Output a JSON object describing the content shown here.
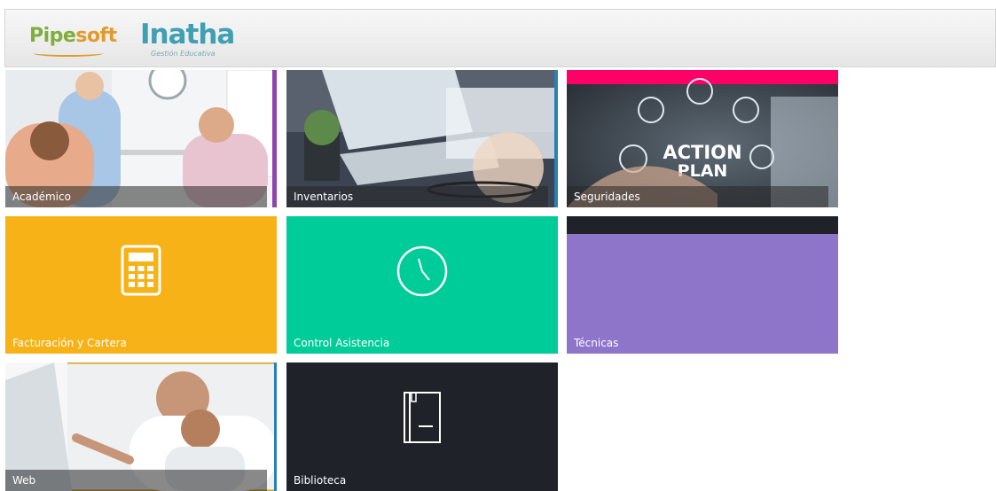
{
  "header": {
    "logo_pipesoft_pre": "Pipe",
    "logo_pipesoft_post": "soft",
    "logo_inatha": "Inatha",
    "logo_inatha_sub": "Gestión Educativa"
  },
  "tiles": [
    {
      "label": "Académico",
      "kind": "photo",
      "accent": "#8e44ad"
    },
    {
      "label": "Inventarios",
      "kind": "photo",
      "accent": "#2980b9"
    },
    {
      "label": "Seguridades",
      "kind": "photo",
      "accent": "#ff0066"
    },
    {
      "label": "Facturación y Cartera",
      "kind": "icon",
      "icon": "calculator-icon",
      "color": "#f7b217"
    },
    {
      "label": "Control Asistencia",
      "kind": "icon",
      "icon": "clock-icon",
      "color": "#00cc99"
    },
    {
      "label": "Técnicas",
      "kind": "plain",
      "color": "#8e75c9",
      "top_band": "#1f2329"
    },
    {
      "label": "Web",
      "kind": "photo",
      "accent": "#d4a017"
    },
    {
      "label": "Biblioteca",
      "kind": "icon",
      "icon": "book-icon",
      "color": "#1f2329"
    }
  ],
  "photo_text": {
    "action": "ACTION",
    "plan": "PLAN"
  }
}
